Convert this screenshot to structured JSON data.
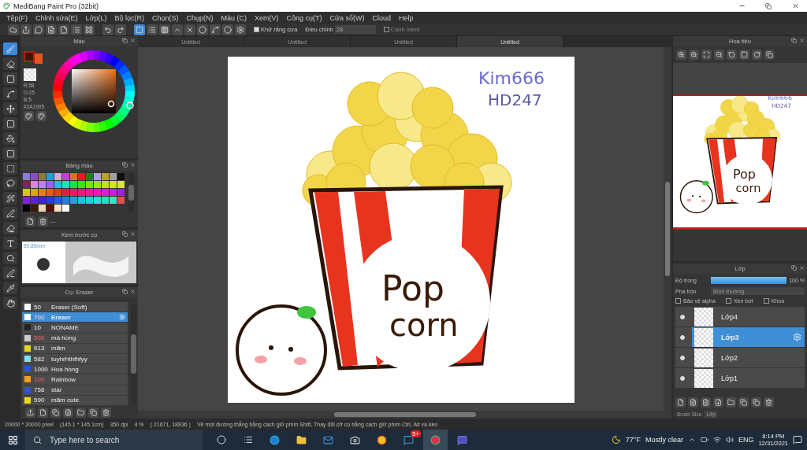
{
  "window": {
    "title": "MediBang Paint Pro (32bit)"
  },
  "menu": [
    "Tệp(F)",
    "Chỉnh sửa(E)",
    "Lớp(L)",
    "Bộ lọc(R)",
    "Chọn(S)",
    "Chụp(N)",
    "Màu (C)",
    "Xem(V)",
    "Công cụ(T)",
    "Cửa sổ(W)",
    "Cloud",
    "Help"
  ],
  "toolbar": {
    "antialias": {
      "label": "Khử răng cưa",
      "checked": true
    },
    "adjust": {
      "label": "Điều chỉnh",
      "value": "28"
    },
    "soft_edge": {
      "label": "Cạnh mềm",
      "checked": false
    }
  },
  "tabs": [
    {
      "label": "Untitled",
      "selected": false
    },
    {
      "label": "Untitled",
      "selected": false
    },
    {
      "label": "Untitled",
      "selected": false
    },
    {
      "label": "Untitled",
      "selected": true
    }
  ],
  "color_panel": {
    "title": "Màu",
    "r": "R:58",
    "g": "G:25",
    "b": "B:5",
    "hex": "#3A1905"
  },
  "palette": {
    "title": "Bảng màu",
    "extra": "---",
    "swatches": [
      {
        "color": "#8a7ae0"
      },
      {
        "color": "#8a4fc0"
      },
      {
        "color": "#8a7a40"
      },
      {
        "color": "#1fa0e0"
      },
      {
        "color": "#e0a0e0"
      },
      {
        "color": "#c040e0"
      },
      {
        "color": "#e07020"
      },
      {
        "color": "#e02020"
      },
      {
        "color": "#208020"
      },
      {
        "color": "#b0a0e0"
      },
      {
        "color": "#c0a020"
      },
      {
        "color": "#a0a0a0"
      },
      {
        "color": "#101010"
      },
      {
        "color": "#802060"
      },
      {
        "color": "#e080e0"
      },
      {
        "color": "#c080f0"
      },
      {
        "color": "#a060f0"
      },
      {
        "color": "#20c0e0"
      },
      {
        "color": "#20e0c0"
      },
      {
        "color": "#20e040"
      },
      {
        "color": "#40e020"
      },
      {
        "color": "#80e020"
      },
      {
        "color": "#a0e020"
      },
      {
        "color": "#c0e020"
      },
      {
        "color": "#e0e020"
      },
      {
        "color": "#e0e040"
      },
      {
        "color": "#e0c020"
      },
      {
        "color": "#e0a020"
      },
      {
        "color": "#e08020"
      },
      {
        "color": "#e06020"
      },
      {
        "color": "#e04020"
      },
      {
        "color": "#e02040"
      },
      {
        "color": "#e02060"
      },
      {
        "color": "#e02080"
      },
      {
        "color": "#e020a0"
      },
      {
        "color": "#e020c0"
      },
      {
        "color": "#d020e0"
      },
      {
        "color": "#c020e0"
      },
      {
        "color": "#a020e0"
      },
      {
        "color": "#8020e0"
      },
      {
        "color": "#6020e0"
      },
      {
        "color": "#4020e0"
      },
      {
        "color": "#2040e0"
      },
      {
        "color": "#2060e0"
      },
      {
        "color": "#2080e0"
      },
      {
        "color": "#20a0e0"
      },
      {
        "color": "#20c0e0"
      },
      {
        "color": "#20d0e0"
      },
      {
        "color": "#20e0e0"
      },
      {
        "color": "#20e0c0"
      },
      {
        "color": "#40e0c0"
      },
      {
        "color": "#e05050"
      },
      {
        "color": "#000000"
      },
      {
        "color": "#3a1905"
      },
      {
        "color": "#e8d8b8"
      },
      {
        "color": "#5a0a0a"
      },
      {
        "color": "#f4e4c4"
      },
      {
        "color": "#ffffff"
      }
    ]
  },
  "brush_preview": {
    "title": "Xem trước cọ",
    "size": "50.80mm"
  },
  "brushes": {
    "title": "Cọ: Eraser",
    "items": [
      {
        "size": "50",
        "name": "Eraser (Soft)",
        "color": "#ffffff",
        "size_warning": false,
        "selected": false
      },
      {
        "size": "700",
        "name": "Eraser",
        "color": "#ffffff",
        "size_warning": true,
        "selected": true
      },
      {
        "size": "10",
        "name": "NONAME",
        "color": "#222222",
        "size_warning": false,
        "selected": false
      },
      {
        "size": "500",
        "name": "má hồng",
        "color": "#cccccc",
        "size_warning": true,
        "selected": false
      },
      {
        "size": "613",
        "name": "mãm",
        "color": "#e8d820",
        "size_warning": false,
        "selected": false
      },
      {
        "size": "582",
        "name": "tuyhrhthfhfyy",
        "color": "#80e0f0",
        "size_warning": false,
        "selected": false
      },
      {
        "size": "1000",
        "name": "Hoa hồng",
        "color": "#3050e0",
        "size_warning": false,
        "selected": false
      },
      {
        "size": "100",
        "name": "Rainbow",
        "color": "#f0a020",
        "size_warning": true,
        "selected": false
      },
      {
        "size": "758",
        "name": "star",
        "color": "#3050e0",
        "size_warning": false,
        "selected": false
      },
      {
        "size": "590",
        "name": "mãm cute",
        "color": "#e8d820",
        "size_warning": false,
        "selected": false
      }
    ]
  },
  "canvas": {
    "signature": [
      "Kim666",
      "HD247"
    ],
    "label": [
      "Pop",
      "corn"
    ]
  },
  "navigator": {
    "title": "Hoa tiêu",
    "signature": [
      "Kim666",
      "HD247"
    ],
    "label": [
      "Pop",
      "corn"
    ]
  },
  "layers": {
    "title": "Lớp",
    "opacity": {
      "label": "Độ trong",
      "level": 1.0,
      "reading": "100 %"
    },
    "blend": {
      "label": "Pha trộn",
      "value": "Bình thường"
    },
    "options": [
      {
        "label": "Bảo vệ alpha",
        "checked": false
      },
      {
        "label": "Xén bớt",
        "checked": false
      },
      {
        "label": "Khóa",
        "checked": false
      }
    ],
    "items": [
      {
        "name": "Lớp4",
        "visible": true,
        "selected": false
      },
      {
        "name": "Lớp3",
        "visible": true,
        "selected": true
      },
      {
        "name": "Lớp2",
        "visible": true,
        "selected": false
      },
      {
        "name": "Lớp1",
        "visible": true,
        "selected": false
      }
    ]
  },
  "bottom_tabs": [
    {
      "label": "Brush Size",
      "selected": false
    },
    {
      "label": "Lớp",
      "selected": true
    }
  ],
  "status_bar": [
    "20000 * 20000 pixel",
    "(145.1 * 145.1cm)",
    "350 dpi",
    "4 %",
    "( 21671, 18836 )",
    "Vẽ một đường thẳng bằng cách giữ phím Shift, Thay đổi cỡ cọ bằng cách giữ phím Ctrl, Alt và kéo"
  ],
  "taskbar": {
    "search_placeholder": "Type here to search",
    "badge": "5+",
    "temperature": "77°F",
    "weather": "Mostly clear",
    "language": "ENG",
    "time": "8:14 PM",
    "date": "12/31/2021"
  }
}
